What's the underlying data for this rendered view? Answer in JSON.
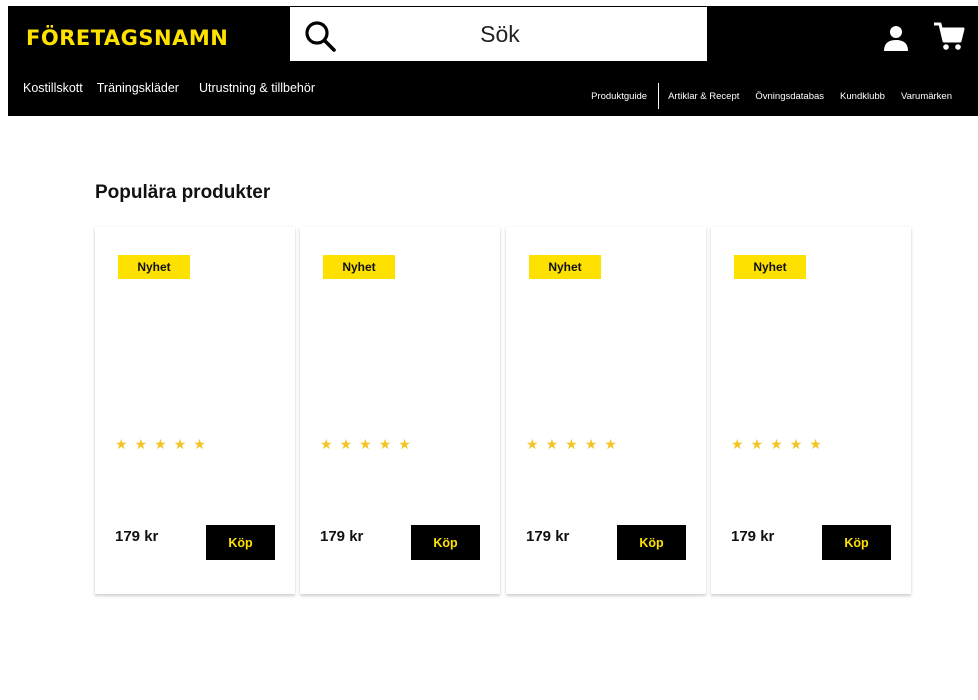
{
  "header": {
    "logo": "FÖRETAGSNAMN",
    "search_placeholder": "Sök",
    "colors": {
      "background": "#000000",
      "accent": "#FFE100"
    },
    "icons": {
      "search": "search-icon",
      "user": "user-icon",
      "cart": "cart-icon"
    }
  },
  "nav": {
    "left": [
      "Kostillskott",
      "Träningskläder",
      "Utrustning & tillbehör"
    ],
    "right": [
      "Produktguide",
      "Artiklar & Recept",
      "Övningsdatabas",
      "Kundklubb",
      "Varumärken"
    ]
  },
  "main": {
    "section_title": "Populära produkter",
    "products": [
      {
        "badge": "Nyhet",
        "rating": 5,
        "price": "179 kr",
        "button": "Köp"
      },
      {
        "badge": "Nyhet",
        "rating": 5,
        "price": "179 kr",
        "button": "Köp"
      },
      {
        "badge": "Nyhet",
        "rating": 5,
        "price": "179 kr",
        "button": "Köp"
      },
      {
        "badge": "Nyhet",
        "rating": 5,
        "price": "179 kr",
        "button": "Köp"
      }
    ]
  }
}
